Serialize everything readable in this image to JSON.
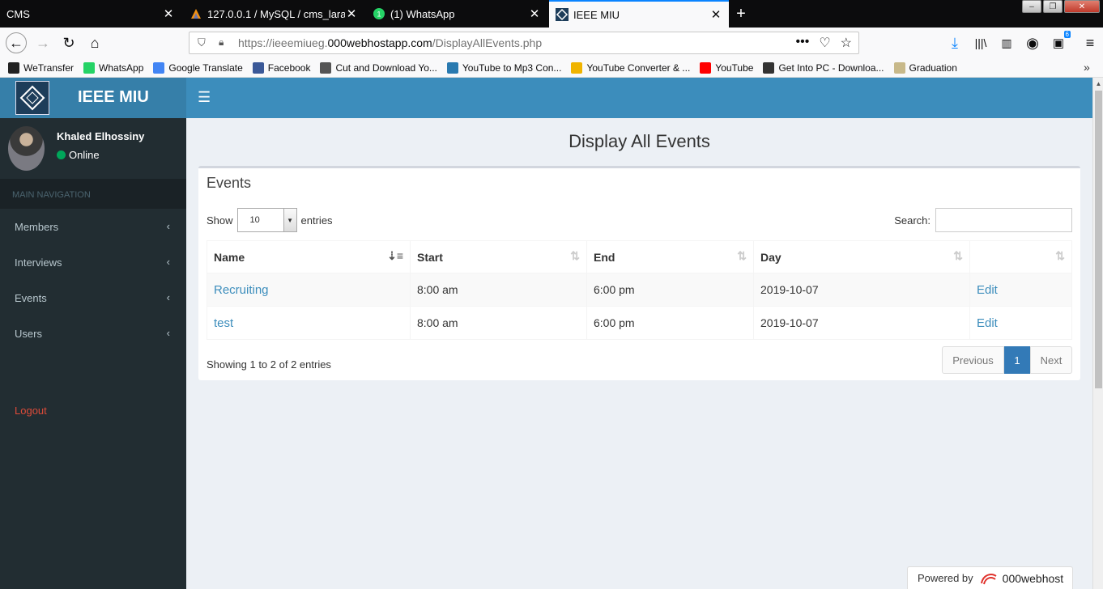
{
  "browser": {
    "tabs": [
      {
        "title": "CMS",
        "active": false
      },
      {
        "title": "127.0.0.1 / MySQL / cms_larave",
        "active": false
      },
      {
        "title": "(1) WhatsApp",
        "active": false
      },
      {
        "title": "IEEE MIU",
        "active": true
      }
    ],
    "url_prefix": "https://ieeemiueg.",
    "url_domain": "000webhostapp.com",
    "url_path": "/DisplayAllEvents.php",
    "download_badge": "6",
    "bookmarks": [
      {
        "label": "WeTransfer",
        "color": "#222222"
      },
      {
        "label": "WhatsApp",
        "color": "#25d366"
      },
      {
        "label": "Google Translate",
        "color": "#4285f4"
      },
      {
        "label": "Facebook",
        "color": "#3b5998"
      },
      {
        "label": "Cut and Download Yo...",
        "color": "#555555"
      },
      {
        "label": "YouTube to Mp3 Con...",
        "color": "#2a7ab0"
      },
      {
        "label": "YouTube Converter & ...",
        "color": "#f0b400"
      },
      {
        "label": "YouTube",
        "color": "#ff0000"
      },
      {
        "label": "Get Into PC - Downloa...",
        "color": "#333333"
      },
      {
        "label": "Graduation",
        "color": "#c8b98a"
      }
    ]
  },
  "app": {
    "brand": "IEEE MIU",
    "user": {
      "name": "Khaled Elhossiny",
      "status": "Online"
    },
    "nav_header": "MAIN NAVIGATION",
    "nav": [
      "Members",
      "Interviews",
      "Events",
      "Users"
    ],
    "logout": "Logout",
    "page_title": "Display All Events",
    "box_title": "Events",
    "show_label": "Show",
    "entries_label": "entries",
    "page_length": "10",
    "search_label": "Search:",
    "columns": [
      "Name",
      "Start",
      "End",
      "Day",
      ""
    ],
    "rows": [
      {
        "name": "Recruiting",
        "start": "8:00 am",
        "end": "6:00 pm",
        "day": "2019-10-07",
        "action": "Edit"
      },
      {
        "name": "test",
        "start": "8:00 am",
        "end": "6:00 pm",
        "day": "2019-10-07",
        "action": "Edit"
      }
    ],
    "info": "Showing 1 to 2 of 2 entries",
    "pagination": {
      "previous": "Previous",
      "current": "1",
      "next": "Next"
    },
    "powered_by": "Powered by",
    "host_brand": "000webhost"
  }
}
